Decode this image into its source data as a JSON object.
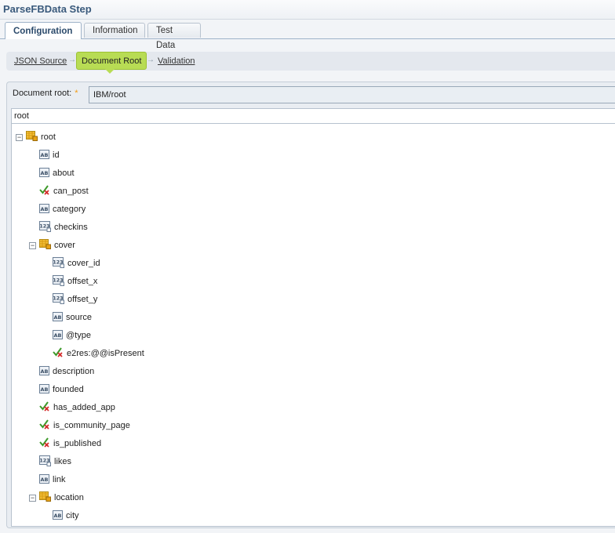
{
  "window": {
    "title": "ParseFBData Step"
  },
  "tabs": [
    {
      "label": "Configuration",
      "active": true
    },
    {
      "label": "Information",
      "active": false
    },
    {
      "label": "Test Data",
      "active": false
    }
  ],
  "breadcrumb": {
    "items": [
      {
        "label": "JSON Source",
        "active": false
      },
      {
        "label": "Document Root",
        "active": true
      },
      {
        "label": "Validation",
        "active": false
      }
    ]
  },
  "document_root": {
    "label": "Document root:",
    "required_marker": "*",
    "value": "IBM/root"
  },
  "tree": {
    "header": "root",
    "nodes": [
      {
        "label": "root",
        "type": "object",
        "expanded": true
      },
      {
        "label": "id",
        "type": "string"
      },
      {
        "label": "about",
        "type": "string"
      },
      {
        "label": "can_post",
        "type": "boolean"
      },
      {
        "label": "category",
        "type": "string"
      },
      {
        "label": "checkins",
        "type": "number"
      },
      {
        "label": "cover",
        "type": "object",
        "expanded": true
      },
      {
        "label": "cover_id",
        "type": "number"
      },
      {
        "label": "offset_x",
        "type": "number"
      },
      {
        "label": "offset_y",
        "type": "number"
      },
      {
        "label": "source",
        "type": "string"
      },
      {
        "label": "@type",
        "type": "string"
      },
      {
        "label": "e2res:@@isPresent",
        "type": "boolean"
      },
      {
        "label": "description",
        "type": "string"
      },
      {
        "label": "founded",
        "type": "string"
      },
      {
        "label": "has_added_app",
        "type": "boolean"
      },
      {
        "label": "is_community_page",
        "type": "boolean"
      },
      {
        "label": "is_published",
        "type": "boolean"
      },
      {
        "label": "likes",
        "type": "number"
      },
      {
        "label": "link",
        "type": "string"
      },
      {
        "label": "location",
        "type": "object",
        "expanded": true
      },
      {
        "label": "city",
        "type": "string"
      }
    ]
  },
  "colors": {
    "active_crumb": "#b8dc54",
    "title_text": "#3a5a7c",
    "required_star": "#f39c12"
  }
}
